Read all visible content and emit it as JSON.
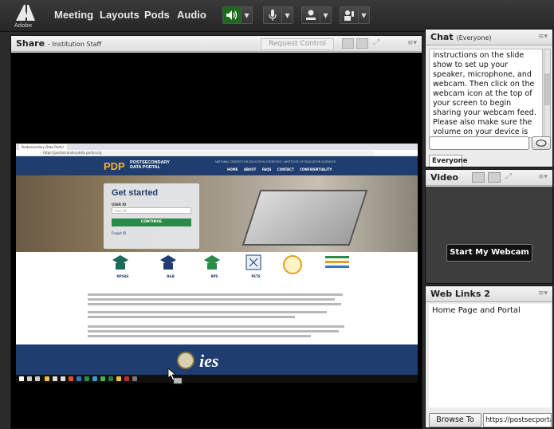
{
  "app": {
    "logo_text": "Adobe"
  },
  "menu": {
    "items": [
      "Meeting",
      "Layouts",
      "Pods",
      "Audio"
    ]
  },
  "toolbar": {
    "speaker_icon": "speaker-icon",
    "mic_icon": "microphone-icon",
    "camera_icon": "webcam-icon",
    "status_icon": "raise-hand-icon",
    "speaker_color": "#1c6b1c"
  },
  "share": {
    "title": "Share",
    "subtitle": "- Institution Staff",
    "request_control": "Request Control",
    "browser": {
      "tab_title": "Postsecondary Data Portal",
      "url": "https://postsecondarydata portal.org",
      "site_logo": "PDP",
      "site_name_line1": "POSTSECONDARY",
      "site_name_line2": "DATA PORTAL",
      "site_tagline": "NATIONAL CENTER FOR EDUCATION STATISTICS | INSTITUTE OF EDUCATION SCIENCES",
      "nav": "HOME ABOUT FAQS CONTACT CONFIDENTIALITY",
      "card_title": "Get started",
      "card_label": "USER ID",
      "card_placeholder": "User ID",
      "card_button": "CONTINUE",
      "card_link": "Forgot ID",
      "studies": [
        "NPSAS",
        "B&B",
        "BPS",
        "PETS"
      ],
      "footer_logo": "ies"
    }
  },
  "chat": {
    "title": "Chat",
    "subtitle": "(Everyone)",
    "message": "instructions on the slide show to set up your speaker, microphone, and webcam. Then click on the webcam icon at the top of your screen to begin sharing your webcam feed. Please also make sure the volume on your device is turned up.",
    "tab": "Everyone"
  },
  "video": {
    "title": "Video",
    "webcam_button": "Start My Webcam"
  },
  "weblinks": {
    "title": "Web Links 2",
    "items": [
      "Home Page and Portal"
    ],
    "browse_button": "Browse To",
    "url": "https://postsecportal"
  }
}
